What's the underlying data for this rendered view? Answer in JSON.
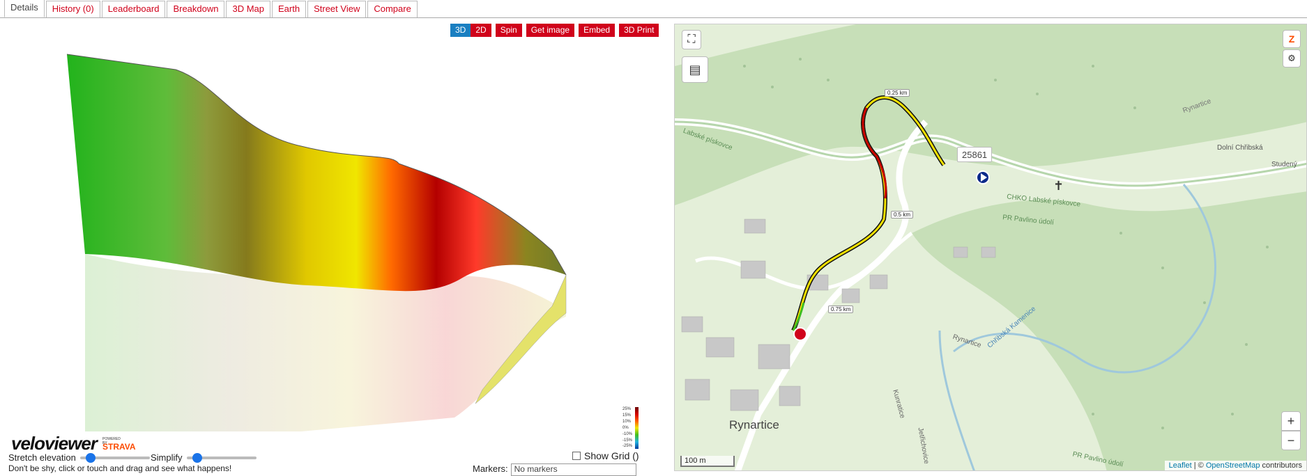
{
  "tabs": [
    {
      "label": "Details",
      "active": true
    },
    {
      "label": "History (0)"
    },
    {
      "label": "Leaderboard"
    },
    {
      "label": "Breakdown"
    },
    {
      "label": "3D Map"
    },
    {
      "label": "Earth"
    },
    {
      "label": "Street View"
    },
    {
      "label": "Compare"
    }
  ],
  "toolbar": {
    "mode_3d": "3D",
    "mode_2d": "2D",
    "spin": "Spin",
    "get_image": "Get image",
    "embed": "Embed",
    "print3d": "3D Print"
  },
  "legend": {
    "ticks": [
      "25%",
      "15%",
      "10%",
      "0%",
      "-10%",
      "-15%",
      "-25%"
    ]
  },
  "brand": {
    "name": "veloviewer",
    "powered_by": "POWERED BY",
    "strava": "STRAVA"
  },
  "controls": {
    "stretch_label": "Stretch elevation",
    "stretch_value": 0.1,
    "simplify_label": "Simplify",
    "simplify_value": 0.1,
    "show_grid_label": "Show Grid ()",
    "hint": "Don't be shy, click or touch and drag and see what happens!",
    "markers_label": "Markers:",
    "markers_value": "No markers"
  },
  "map": {
    "zoom_in": "+",
    "zoom_out": "−",
    "scale": "100 m",
    "attribution": {
      "leaflet": "Leaflet",
      "sep": " | © ",
      "osm": "OpenStreetMap",
      "suffix": " contributors"
    },
    "road_number": "25861",
    "town": "Rynartice",
    "labels": {
      "a": "CHKO Labské pískovce",
      "b": "PR Pavlino údolí",
      "c": "Dolní Chřibská",
      "d": "Rynartice",
      "e": "Studený",
      "f": "Chřibská Kamenice",
      "g": "PR Pavlino údolí",
      "h": "Kunratice",
      "i": "Jetřichovice",
      "j": "Rynartice",
      "k": "Labské pískovce"
    },
    "km_markers": [
      "0.25 km",
      "0.5 km",
      "0.75 km"
    ]
  }
}
